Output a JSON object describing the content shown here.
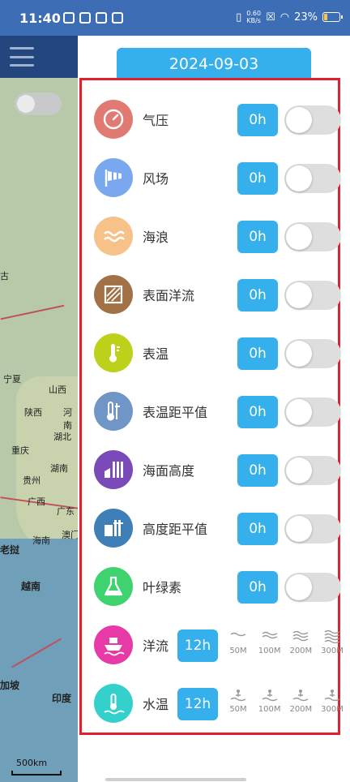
{
  "status_bar": {
    "time": "11:40",
    "net_speed_value": "0.60",
    "net_speed_unit": "KB/s",
    "battery": "23%",
    "battery_level": 0.23
  },
  "map": {
    "labels": [
      "古",
      "宁夏",
      "山西",
      "河南",
      "陕西",
      "湖北",
      "重庆",
      "湖南",
      "贵州",
      "广西",
      "广东",
      "海南",
      "澳门",
      "老挝",
      "越南",
      "加坡",
      "印度"
    ],
    "scale": "500km"
  },
  "panel": {
    "date": "2024-09-03",
    "layers": [
      {
        "label": "气压",
        "hours": "0h",
        "on": false,
        "icon": "gauge-icon",
        "color": "#e27a74"
      },
      {
        "label": "风场",
        "hours": "0h",
        "on": false,
        "icon": "windsock-icon",
        "color": "#79a8ee"
      },
      {
        "label": "海浪",
        "hours": "0h",
        "on": false,
        "icon": "wave-icon",
        "color": "#f6c28a"
      },
      {
        "label": "表面洋流",
        "hours": "0h",
        "on": false,
        "icon": "current-icon",
        "color": "#a27246"
      },
      {
        "label": "表温",
        "hours": "0h",
        "on": false,
        "icon": "thermometer-icon",
        "color": "#bdd01a"
      },
      {
        "label": "表温距平值",
        "hours": "0h",
        "on": false,
        "icon": "thermo-anomaly-icon",
        "color": "#6f96c6"
      },
      {
        "label": "海面高度",
        "hours": "0h",
        "on": false,
        "icon": "sea-height-icon",
        "color": "#7a4ab8"
      },
      {
        "label": "高度距平值",
        "hours": "0h",
        "on": false,
        "icon": "height-anomaly-icon",
        "color": "#3d7fb6"
      },
      {
        "label": "叶绿素",
        "hours": "0h",
        "on": false,
        "icon": "flask-icon",
        "color": "#3fd36f"
      }
    ],
    "depth_layers": [
      {
        "label": "洋流",
        "hours": "12h",
        "icon": "ship-icon",
        "color": "#e83aa6",
        "depth_icon": "wave-lines-icon",
        "depths": [
          "50M",
          "100M",
          "200M",
          "300M"
        ]
      },
      {
        "label": "水温",
        "hours": "12h",
        "icon": "water-temp-icon",
        "color": "#34d1cc",
        "depth_icon": "swimmer-icon",
        "depths": [
          "50M",
          "100M",
          "200M",
          "300M"
        ]
      }
    ]
  }
}
